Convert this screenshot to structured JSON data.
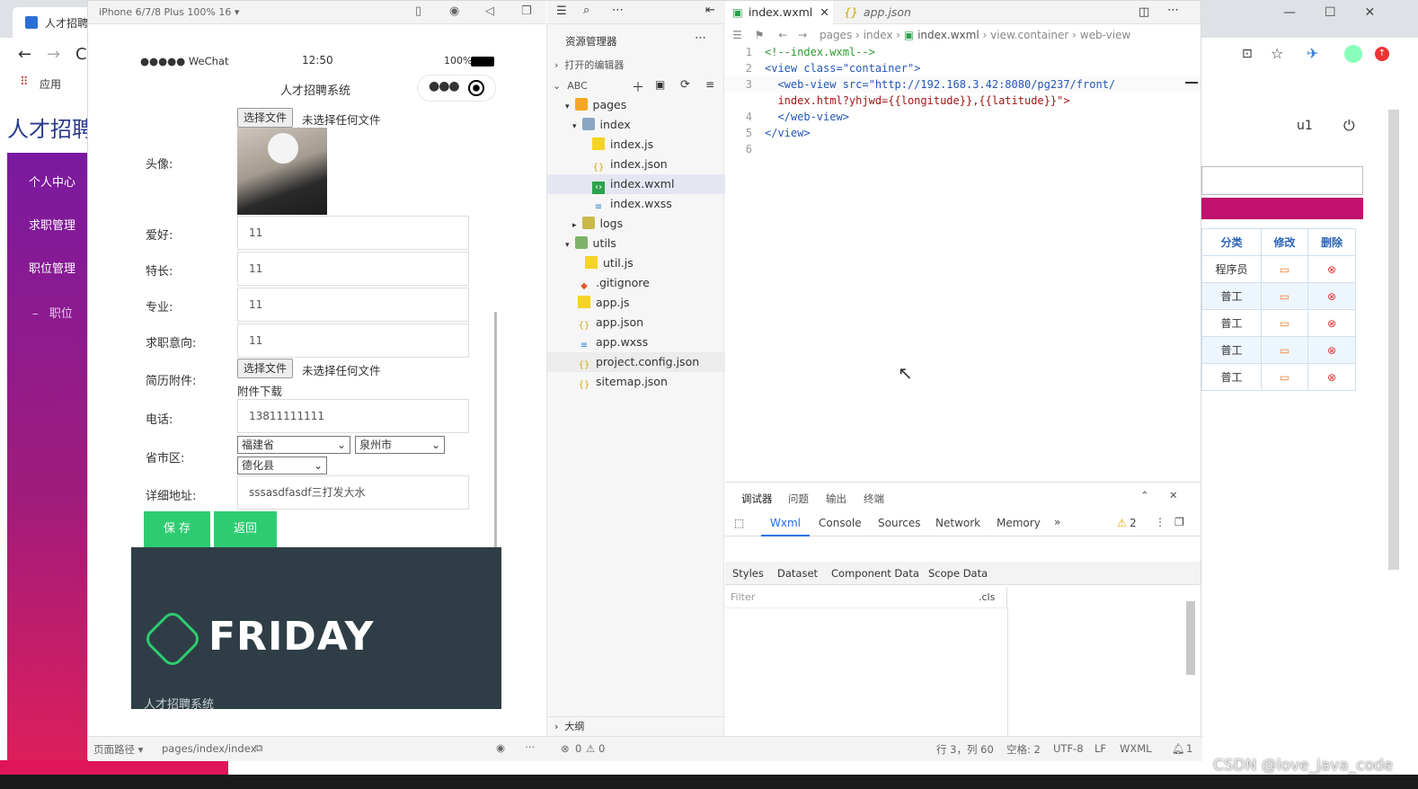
{
  "browser": {
    "tab_title": "人才招聘",
    "apps_label": "应用",
    "site_title": "人才招聘",
    "sidebar": [
      "个人中心",
      "求职管理",
      "职位管理"
    ],
    "sidebar_sub": "职位",
    "user": "u1",
    "table": {
      "headers": [
        "分类",
        "修改",
        "删除"
      ],
      "rows": [
        "程序员",
        "普工",
        "普工",
        "普工",
        "普工"
      ]
    }
  },
  "simulator": {
    "device": "iPhone 6/7/8 Plus 100% 16 ▾"
  },
  "phone": {
    "carrier": "●●●●● WeChat",
    "time": "12:50",
    "battery": "100%",
    "title": "人才招聘系统",
    "choose_file": "选择文件",
    "no_file": "未选择任何文件",
    "labels": {
      "avatar": "头像:",
      "hobby": "爱好:",
      "specialty": "特长:",
      "major": "专业:",
      "intention": "求职意向:",
      "resume": "简历附件:",
      "phone": "电话:",
      "region": "省市区:",
      "address": "详细地址:"
    },
    "values": {
      "hobby": "11",
      "specialty": "11",
      "major": "11",
      "intention": "11",
      "phone": "13811111111",
      "address": "sssasdfasdf三打发大水"
    },
    "download": "附件下载",
    "province": "福建省",
    "city": "泉州市",
    "county": "德化县",
    "save": "保 存",
    "back": "返回",
    "brand": "FRIDAY",
    "footer": "人才招聘系统"
  },
  "explorer": {
    "title": "资源管理器",
    "open_editors": "打开的编辑器",
    "project": "ABC",
    "outline": "大纲",
    "tree": [
      {
        "name": "pages",
        "type": "folder"
      },
      {
        "name": "index",
        "type": "folder"
      },
      {
        "name": "index.js",
        "type": "js"
      },
      {
        "name": "index.json",
        "type": "json"
      },
      {
        "name": "index.wxml",
        "type": "wxml"
      },
      {
        "name": "index.wxss",
        "type": "wxss"
      },
      {
        "name": "logs",
        "type": "folder"
      },
      {
        "name": "utils",
        "type": "folder"
      },
      {
        "name": "util.js",
        "type": "js"
      },
      {
        "name": ".gitignore",
        "type": "git"
      },
      {
        "name": "app.js",
        "type": "js"
      },
      {
        "name": "app.json",
        "type": "json"
      },
      {
        "name": "app.wxss",
        "type": "wxss"
      },
      {
        "name": "project.config.json",
        "type": "json"
      },
      {
        "name": "sitemap.json",
        "type": "json"
      }
    ]
  },
  "editor": {
    "tabs": [
      "index.wxml",
      "app.json"
    ],
    "breadcrumb": [
      "pages",
      "index",
      "index.wxml",
      "view.container",
      "web-view"
    ],
    "lines": [
      "<!--index.wxml-->",
      "<view class=\"container\">",
      "  <web-view src=\"http://192.168.3.42:8080/pg237/front/",
      "  index.html?yhjwd={{longitude}},{{latitude}}\">",
      "  </web-view>",
      "</view>",
      ""
    ],
    "line_numbers": [
      "1",
      "2",
      "3",
      "",
      "4",
      "5",
      "6"
    ]
  },
  "debug": {
    "tabs": [
      "调试器",
      "问题",
      "输出",
      "终端"
    ],
    "subtabs": [
      "Wxml",
      "Console",
      "Sources",
      "Network",
      "Memory"
    ],
    "warnings": "2",
    "panel_tabs": [
      "Styles",
      "Dataset",
      "Component Data",
      "Scope Data"
    ],
    "filter_placeholder": "Filter",
    "cls": ".cls"
  },
  "status": {
    "path_label": "页面路径 ▾",
    "path": "pages/index/index",
    "errors": "0",
    "warns": "0",
    "position": "行 3，列 60",
    "spaces": "空格: 2",
    "encoding": "UTF-8",
    "eol": "LF",
    "lang": "WXML",
    "bell": "1"
  },
  "watermark": "CSDN @love_java_code",
  "colors": {
    "accent_green": "#2ecc71",
    "footer_dark": "#2f3e46",
    "magenta": "#c0126c"
  }
}
